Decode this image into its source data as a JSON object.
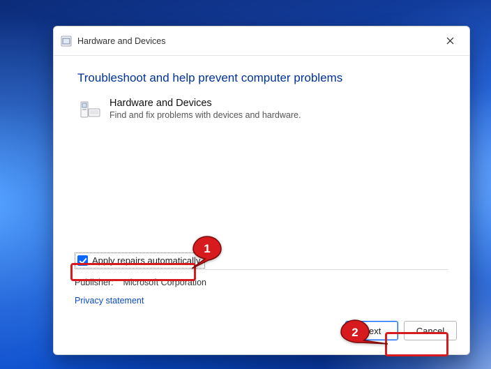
{
  "titlebar": {
    "text": "Hardware and Devices"
  },
  "heading": "Troubleshoot and help prevent computer problems",
  "troubleshooter": {
    "title": "Hardware and Devices",
    "description": "Find and fix problems with devices and hardware."
  },
  "apply_repairs_label": "Apply repairs automatically",
  "publisher_label": "Publisher:",
  "publisher_value": "Microsoft Corporation",
  "privacy_link": "Privacy statement",
  "buttons": {
    "next_prefix": "N",
    "next_rest": "ext",
    "cancel": "Cancel"
  },
  "annotations": {
    "one": "1",
    "two": "2"
  }
}
